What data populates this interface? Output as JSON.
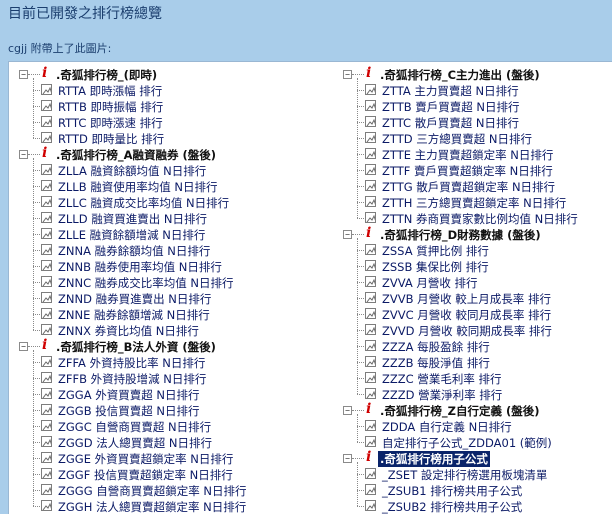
{
  "page_title": "目前已開發之排行榜總覽",
  "attach_note": "cgjj 附帶上了此圖片:",
  "left_groups": [
    {
      "label": ".奇狐排行榜_(即時)",
      "items": [
        "RTTA 即時漲幅 排行",
        "RTTB 即時振幅 排行",
        "RTTC 即時漲速 排行",
        "RTTD 即時量比 排行"
      ]
    },
    {
      "label": ".奇狐排行榜_A融資融券 (盤後)",
      "items": [
        "ZLLA 融資餘額均值 N日排行",
        "ZLLB 融資使用率均值 N日排行",
        "ZLLC 融資成交比率均值 N日排行",
        "ZLLD 融資買進賣出 N日排行",
        "ZLLE 融資餘額增減 N日排行",
        "ZNNA 融券餘額均值 N日排行",
        "ZNNB 融券使用率均值 N日排行",
        "ZNNC 融券成交比率均值 N日排行",
        "ZNND 融券買進賣出 N日排行",
        "ZNNE 融券餘額增減 N日排行",
        "ZNNX 券資比均值 N日排行"
      ]
    },
    {
      "label": ".奇狐排行榜_B法人外資 (盤後)",
      "items": [
        "ZFFA 外資持股比率 N日排行",
        "ZFFB 外資持股增減 N日排行",
        "ZGGA 外資買賣超 N日排行",
        "ZGGB 投信買賣超 N日排行",
        "ZGGC 自營商買賣超 N日排行",
        "ZGGD 法人總買賣超 N日排行",
        "ZGGE 外資買賣超鎖定率 N日排行",
        "ZGGF 投信買賣超鎖定率 N日排行",
        "ZGGG 自營商買賣超鎖定率 N日排行",
        "ZGGH 法人總買賣超鎖定率 N日排行"
      ]
    }
  ],
  "right_groups": [
    {
      "label": ".奇狐排行榜_C主力進出 (盤後)",
      "items": [
        "ZTTA 主力買賣超 N日排行",
        "ZTTB 賣戶買賣超 N日排行",
        "ZTTC 散戶買賣超 N日排行",
        "ZTTD 三方總買賣超 N日排行",
        "ZTTE 主力買賣超鎖定率 N日排行",
        "ZTTF 賣戶買賣超鎖定率 N日排行",
        "ZTTG 散戶買賣超鎖定率 N日排行",
        "ZTTH 三方總買賣超鎖定率 N日排行",
        "ZTTN 券商買賣家數比例均值 N日排行"
      ]
    },
    {
      "label": ".奇狐排行榜_D財務數據 (盤後)",
      "items": [
        "ZSSA 質押比例 排行",
        "ZSSB 集保比例 排行",
        "ZVVA 月營收 排行",
        "ZVVB 月營收 較上月成長率 排行",
        "ZVVC 月營收 較同月成長率 排行",
        "ZVVD 月營收 較同期成長率 排行",
        "ZZZA 每股盈餘 排行",
        "ZZZB 每股淨值 排行",
        "ZZZC 營業毛利率 排行",
        "ZZZD 營業淨利率 排行"
      ]
    },
    {
      "label": ".奇狐排行榜_Z自行定義 (盤後)",
      "items": [
        "ZDDA 自行定義 N日排行",
        "自定排行子公式_ZDDA01 (範例)"
      ]
    },
    {
      "label": ".奇狐排行榜用子公式",
      "selected": true,
      "items": [
        "_ZSET 設定排行榜選用板塊清單",
        "_ZSUB1 排行榜共用子公式",
        "_ZSUB2 排行榜共用子公式"
      ]
    }
  ],
  "icons": {
    "group": "red-info-icon",
    "leaf": "image-placeholder-icon",
    "toggle": "collapse-minus-icon"
  },
  "colors": {
    "background": "#a9cdea",
    "selected": "#0a246a",
    "info_icon": "#d00000",
    "leaf_text": "#0b1a66"
  }
}
